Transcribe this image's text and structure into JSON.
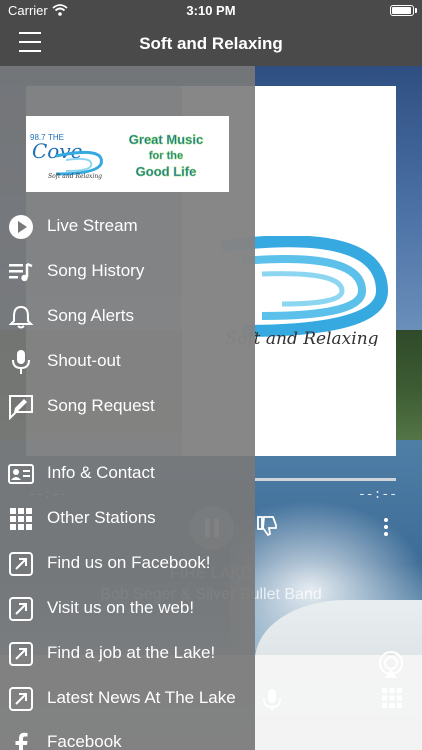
{
  "status_bar": {
    "carrier": "Carrier",
    "time": "3:10 PM"
  },
  "nav": {
    "title": "Soft and Relaxing"
  },
  "logo": {
    "station": "98.7",
    "the": "THE",
    "name": "Cove",
    "tagline": "Soft and Relaxing",
    "slogan_line1": "Great Music",
    "slogan_line2": "for the",
    "slogan_line3": "Good Life"
  },
  "artwork": {
    "script": "Soft and Relaxing"
  },
  "player": {
    "time_elapsed": "--:--",
    "time_remaining": "--:--",
    "track_title": "FIRE LAKE",
    "track_artist": "Bob Seger & Silver Bullet Band"
  },
  "menu": {
    "items": [
      {
        "label": "Live Stream",
        "icon": "play-circle-icon"
      },
      {
        "label": "Song History",
        "icon": "playlist-icon"
      },
      {
        "label": "Song Alerts",
        "icon": "bell-icon"
      },
      {
        "label": "Shout-out",
        "icon": "microphone-icon"
      },
      {
        "label": "Song Request",
        "icon": "request-icon"
      },
      {
        "label": "Info & Contact",
        "icon": "contact-card-icon"
      },
      {
        "label": "Other Stations",
        "icon": "grid-icon"
      },
      {
        "label": "Find us on Facebook!",
        "icon": "external-link-icon"
      },
      {
        "label": "Visit us on the web!",
        "icon": "external-link-icon"
      },
      {
        "label": "Find a job at the Lake!",
        "icon": "external-link-icon"
      },
      {
        "label": "Latest News At The Lake",
        "icon": "external-link-icon"
      },
      {
        "label": "Facebook",
        "icon": "facebook-icon"
      }
    ]
  },
  "colors": {
    "bar": "#4a4a4a",
    "drawer": "#787878",
    "accent_blue": "#2a9fd6"
  }
}
